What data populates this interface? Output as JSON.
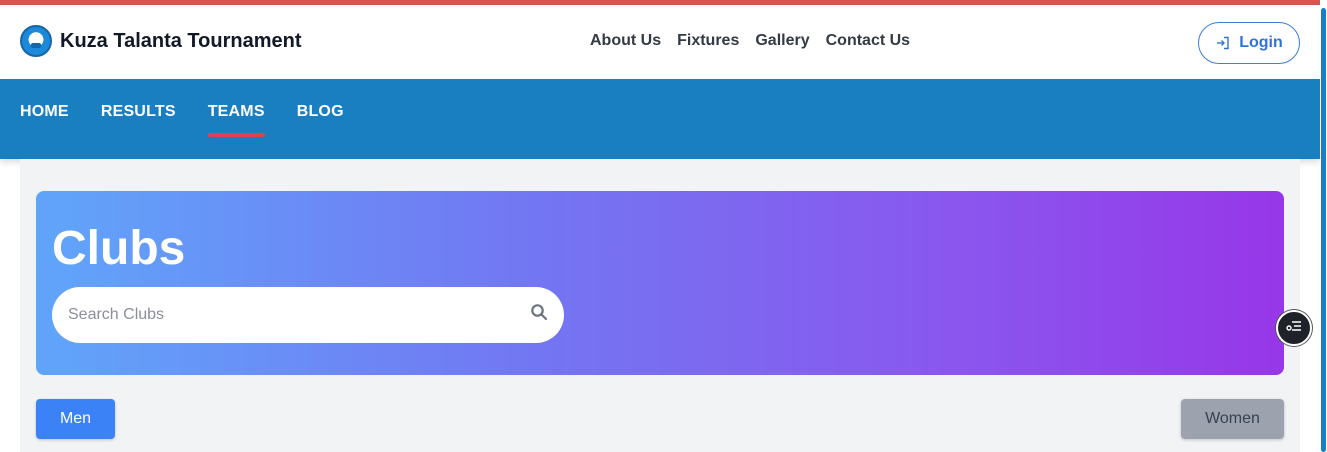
{
  "brand": {
    "name": "Kuza Talanta Tournament",
    "logo_icon": "football-logo-icon"
  },
  "top_nav": [
    {
      "label": "About Us"
    },
    {
      "label": "Fixtures"
    },
    {
      "label": "Gallery"
    },
    {
      "label": "Contact Us"
    }
  ],
  "login": {
    "label": "Login",
    "icon": "login-icon"
  },
  "main_nav": [
    {
      "label": "HOME",
      "active": false
    },
    {
      "label": "RESULTS",
      "active": false
    },
    {
      "label": "TEAMS",
      "active": true
    },
    {
      "label": "BLOG",
      "active": false
    }
  ],
  "hero": {
    "title": "Clubs",
    "search": {
      "placeholder": "Search Clubs",
      "value": "",
      "icon": "search-icon"
    }
  },
  "gender_tabs": {
    "men_label": "Men",
    "women_label": "Women",
    "selected": "Men"
  },
  "floating_button": {
    "icon": "list-settings-icon"
  },
  "colors": {
    "accent_stripe": "#d9534f",
    "nav_blue": "#1a7fc1",
    "active_underline": "#e2414e",
    "men_button": "#3b82f6",
    "women_button": "#9ca3af",
    "hero_gradient_start": "#60a5fa",
    "hero_gradient_end": "#9737e8"
  }
}
